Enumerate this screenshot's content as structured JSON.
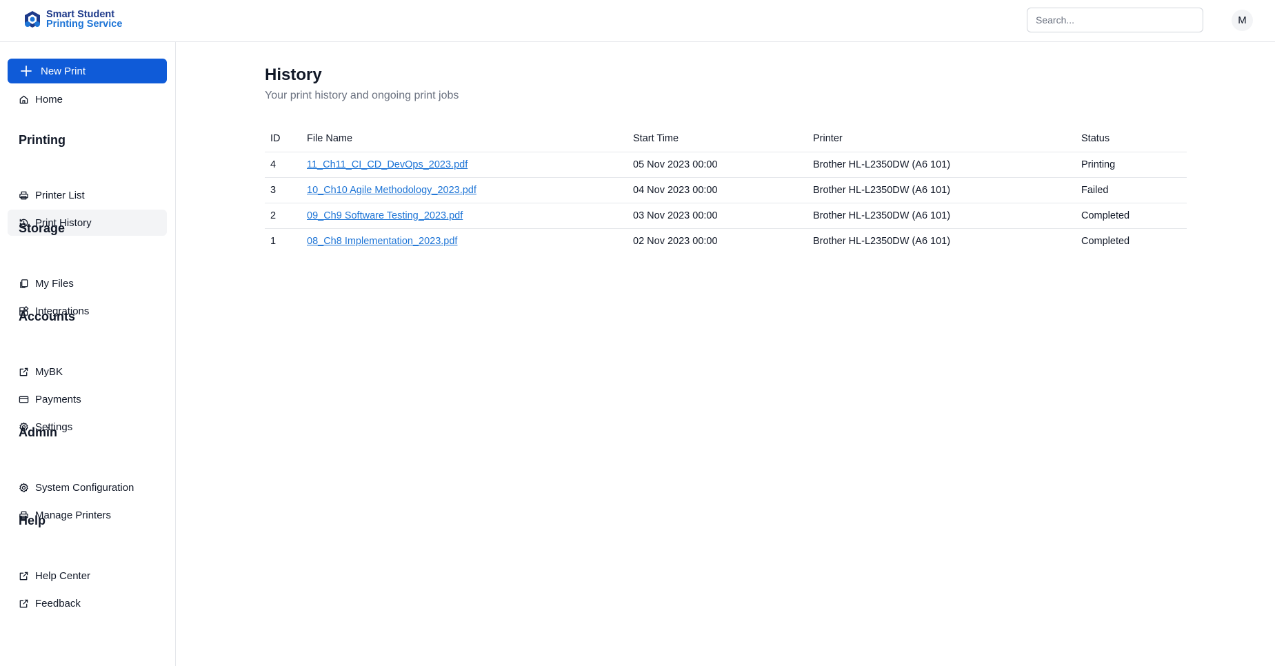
{
  "brand": {
    "line1": "Smart Student",
    "line2": "Printing Service",
    "primary_color": "#1e3a8a",
    "accent_color": "#1d74d6",
    "logo_icon": "brand-logo-icon"
  },
  "header": {
    "search_placeholder": "Search...",
    "avatar_initial": "M"
  },
  "sidebar": {
    "new_print_label": "New Print",
    "new_print_color": "#0f5bd8",
    "home": {
      "label": "Home",
      "icon": "home-icon"
    },
    "sections": [
      {
        "title": "Printing",
        "items": [
          {
            "label": "Printer List",
            "icon": "printer-icon"
          },
          {
            "label": "Print History",
            "icon": "history-icon",
            "active": true
          }
        ]
      },
      {
        "title": "Storage",
        "items": [
          {
            "label": "My Files",
            "icon": "files-icon"
          },
          {
            "label": "Integrations",
            "icon": "integrations-icon"
          }
        ]
      },
      {
        "title": "Accounts",
        "items": [
          {
            "label": "MyBK",
            "icon": "external-link-icon"
          },
          {
            "label": "Payments",
            "icon": "credit-card-icon"
          },
          {
            "label": "Settings",
            "icon": "gear-icon"
          }
        ]
      },
      {
        "title": "Admin",
        "items": [
          {
            "label": "System Configuration",
            "icon": "gear-icon"
          },
          {
            "label": "Manage Printers",
            "icon": "printer-icon"
          }
        ]
      },
      {
        "title": "Help",
        "items": [
          {
            "label": "Help Center",
            "icon": "external-link-icon"
          },
          {
            "label": "Feedback",
            "icon": "external-link-icon"
          }
        ]
      }
    ]
  },
  "main": {
    "title": "History",
    "subtitle": "Your print history and ongoing print jobs",
    "table": {
      "columns": [
        "ID",
        "File Name",
        "Start Time",
        "Printer",
        "Status"
      ],
      "rows": [
        {
          "id": "4",
          "file": "11_Ch11_CI_CD_DevOps_2023.pdf",
          "start": "05 Nov 2023 00:00",
          "printer": "Brother HL-L2350DW (A6 101)",
          "status": "Printing"
        },
        {
          "id": "3",
          "file": "10_Ch10 Agile Methodology_2023.pdf",
          "start": "04 Nov 2023 00:00",
          "printer": "Brother HL-L2350DW (A6 101)",
          "status": "Failed"
        },
        {
          "id": "2",
          "file": "09_Ch9 Software Testing_2023.pdf",
          "start": "03 Nov 2023 00:00",
          "printer": "Brother HL-L2350DW (A6 101)",
          "status": "Completed"
        },
        {
          "id": "1",
          "file": "08_Ch8 Implementation_2023.pdf",
          "start": "02 Nov 2023 00:00",
          "printer": "Brother HL-L2350DW (A6 101)",
          "status": "Completed"
        }
      ]
    }
  }
}
